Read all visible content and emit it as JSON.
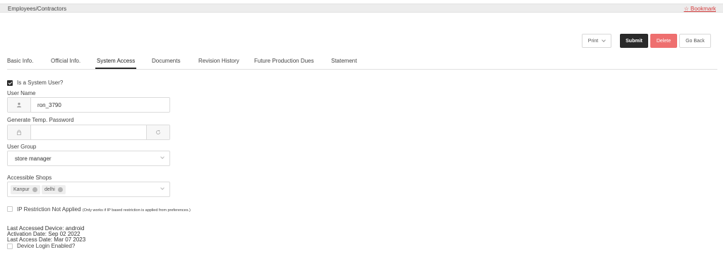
{
  "header": {
    "breadcrumb": "Employees/Contractors",
    "bookmark_label": "Bookmark"
  },
  "actions": {
    "print": "Print",
    "submit": "Submit",
    "delete": "Delete",
    "go_back": "Go Back"
  },
  "tabs": [
    {
      "label": "Basic Info."
    },
    {
      "label": "Official Info."
    },
    {
      "label": "System Access"
    },
    {
      "label": "Documents"
    },
    {
      "label": "Revision History"
    },
    {
      "label": "Future Production Dues"
    },
    {
      "label": "Statement"
    }
  ],
  "active_tab": "System Access",
  "form": {
    "is_system_user": {
      "label": "Is a System User?",
      "checked": true
    },
    "user_name": {
      "label": "User Name",
      "value": "ron_3790"
    },
    "temp_password": {
      "label": "Generate Temp. Password",
      "value": ""
    },
    "user_group": {
      "label": "User Group",
      "value": "store manager"
    },
    "accessible_shops": {
      "label": "Accessible Shops",
      "tags": [
        "Kanpur",
        "delhi"
      ]
    },
    "ip_restriction": {
      "label": "IP Restriction Not Applied",
      "note": "(Only works if IP based restriction is applied from preferences.)",
      "checked": false
    },
    "device_login": {
      "label": "Device Login Enabled?",
      "checked": false
    }
  },
  "device_info": {
    "last_device": "Last Accessed Device: android",
    "activation": "Activation Date: Sep 02 2022",
    "last_access": "Last Access Date: Mar 07 2023"
  },
  "colors": {
    "accent_dark": "#2a2a2a",
    "danger": "#ee6f6f",
    "link_red": "#d43c3c"
  }
}
